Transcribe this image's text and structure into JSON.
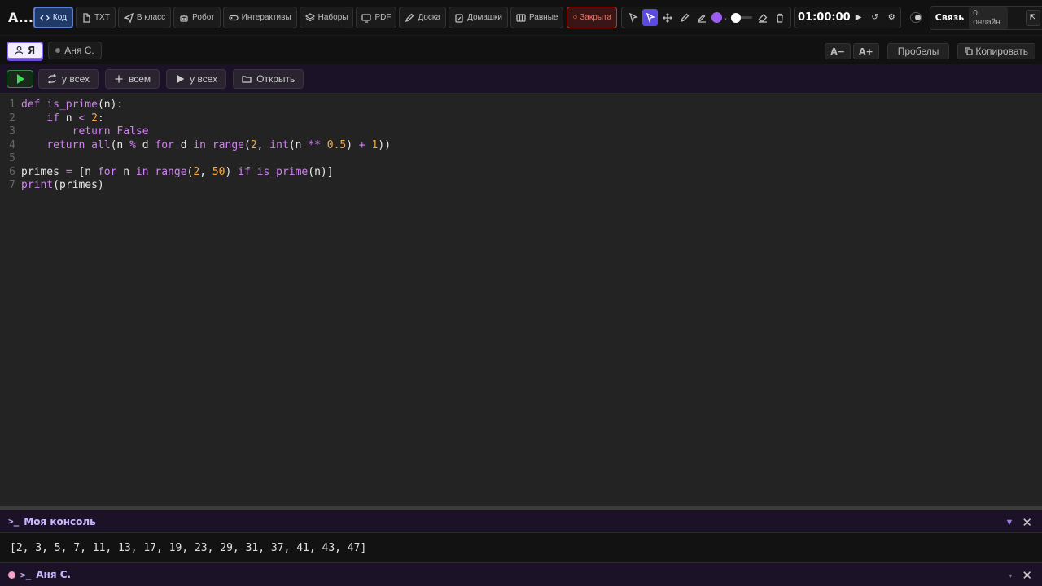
{
  "app": {
    "title": "A..."
  },
  "toolbar": {
    "tabs": [
      {
        "label": "Код"
      },
      {
        "label": "TXT"
      },
      {
        "label": "В класс"
      },
      {
        "label": "Робот"
      },
      {
        "label": "Интерактивы"
      },
      {
        "label": "Наборы"
      },
      {
        "label": "PDF"
      },
      {
        "label": "Доска"
      },
      {
        "label": "Домашки"
      },
      {
        "label": "Равные"
      }
    ],
    "closed_label": "○ Закрыта",
    "draw_color": "#9b5cf0",
    "timer": {
      "value": "01:00:00",
      "play": "▶",
      "reset": "↺",
      "settings": "⚙"
    },
    "link": {
      "title": "Связь",
      "online": "0 онлайн",
      "collapse": "⇱",
      "more": "•"
    }
  },
  "users": {
    "me": "Я",
    "other": "Аня С."
  },
  "editor_tools": {
    "font_minus": "A−",
    "font_plus": "A+",
    "spaces": "Пробелы",
    "copy": "Копировать"
  },
  "runbar": {
    "for_all_label": "у всех",
    "add_all_label": "всем",
    "run_all_label": "у всех",
    "open_label": "Открыть"
  },
  "code_lines": [
    {
      "num": "1"
    },
    {
      "num": "2"
    },
    {
      "num": "3"
    },
    {
      "num": "4"
    },
    {
      "num": "5"
    },
    {
      "num": "6"
    },
    {
      "num": "7"
    }
  ],
  "console": {
    "title": "Моя консоль",
    "prompt": ">_",
    "output": "[2, 3, 5, 7, 11, 13, 17, 19, 23, 29, 31, 37, 41, 43, 47]",
    "collapse": "▼",
    "close": "✕"
  },
  "console2": {
    "title": "Аня С.",
    "prompt": ">_",
    "caret": "▾",
    "close": "✕"
  }
}
